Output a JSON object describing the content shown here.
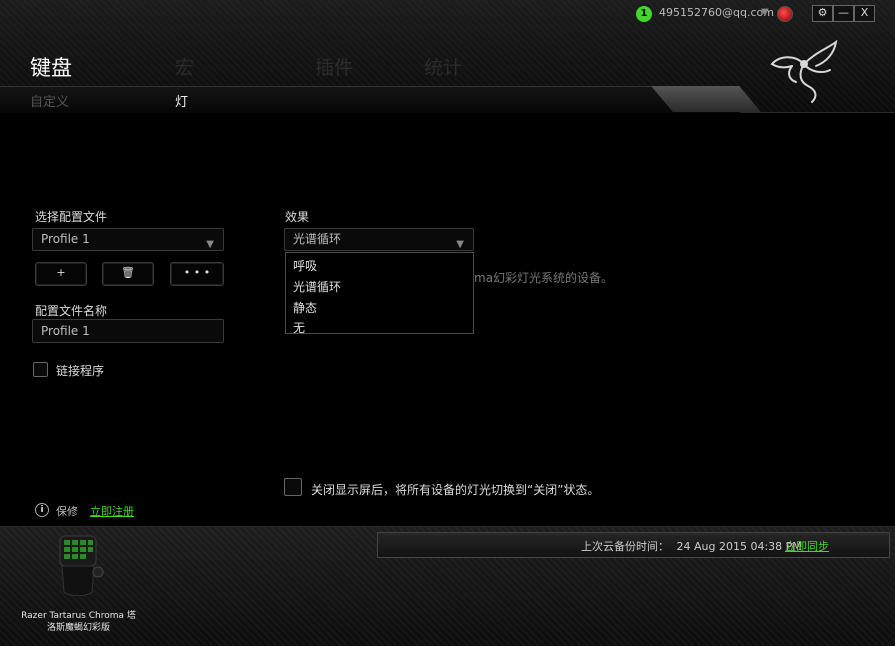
{
  "header": {
    "notification_count": "1",
    "account": "495152760@qq.com",
    "tabs": [
      {
        "label": "键盘"
      },
      {
        "label": "宏"
      },
      {
        "label": "插件"
      },
      {
        "label": "统计"
      }
    ],
    "subtabs": [
      {
        "label": "自定义"
      },
      {
        "label": "灯"
      }
    ],
    "window_buttons": {
      "settings": "⚙",
      "minimize": "—",
      "close": "X"
    }
  },
  "profile": {
    "select_label": "选择配置文件",
    "selected": "Profile 1",
    "add_label": "+",
    "delete_label": "🗑",
    "more_label": "• • •",
    "name_label": "配置文件名称",
    "name_value": "Profile 1",
    "link_program_label": "链接程序"
  },
  "effect": {
    "label": "效果",
    "selected": "光谱循环",
    "options": [
      "呼吸",
      "光谱循环",
      "静态",
      "无"
    ],
    "hint_text": "ma幻彩灯光系统的设备。"
  },
  "display_off_label": "关闭显示屏后，将所有设备的灯光切换到“关闭”状态。",
  "warranty": {
    "label": "保修",
    "link": "立即注册"
  },
  "footer": {
    "backup_label": "上次云备份时间：",
    "backup_time": "24 Aug 2015 04:38 PM",
    "sync_link": "立即同步",
    "device_name_line1": "Razer Tartarus Chroma 塔",
    "device_name_line2": "洛斯魔蝎幻彩版"
  },
  "colors": {
    "accent": "#44d62c",
    "background": "#000000"
  }
}
